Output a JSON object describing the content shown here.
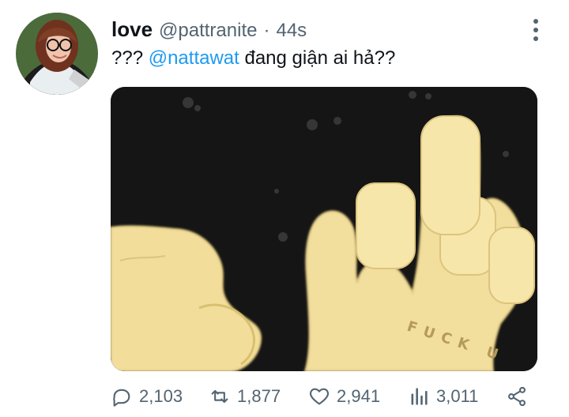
{
  "tweet": {
    "display_name": "love",
    "handle": "@pattranite",
    "separator": "·",
    "timestamp": "44s",
    "text_prefix": "???",
    "mention": "@nattawat",
    "text_suffix": "đang giận ai hả??"
  },
  "media": {
    "stamped_text": "FUCK U"
  },
  "actions": {
    "replies": "2,103",
    "retweets": "1,877",
    "likes": "2,941",
    "views": "3,011"
  },
  "colors": {
    "accent": "#1d9bf0",
    "text": "#0f1419",
    "secondary": "#536471"
  },
  "icons": [
    "more-icon",
    "reply-icon",
    "retweet-icon",
    "like-icon",
    "views-icon",
    "share-icon"
  ]
}
